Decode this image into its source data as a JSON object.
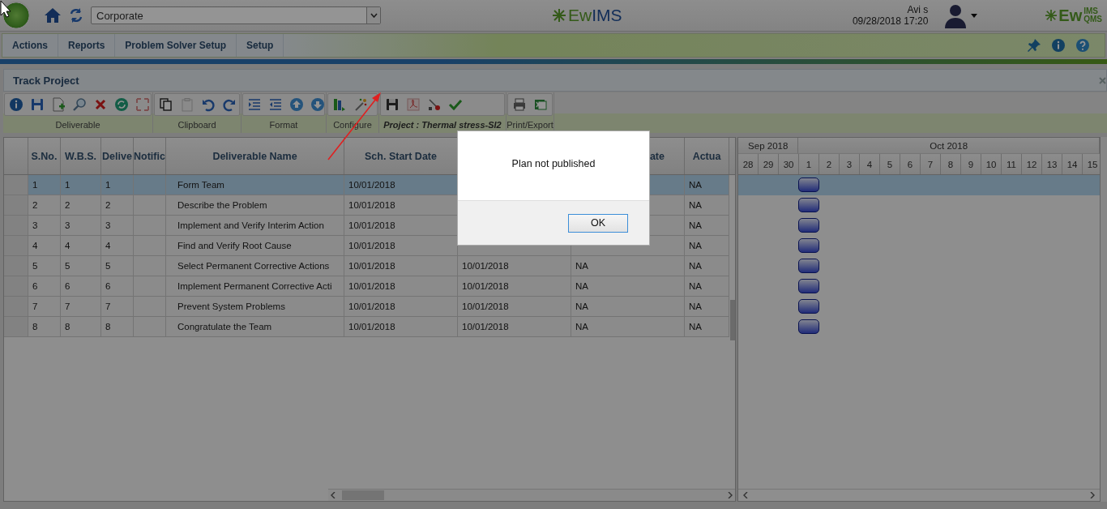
{
  "header": {
    "organization": "Corporate",
    "brand_first": "Ew",
    "brand_second": "IMS",
    "user_name": "Avi s",
    "datetime": "09/28/2018 17:20",
    "corner_logo": {
      "main": "Ew",
      "top": "IMS",
      "bottom": "QMS"
    }
  },
  "menu": [
    "Actions",
    "Reports",
    "Problem Solver Setup",
    "Setup"
  ],
  "panel": {
    "title": "Track Project"
  },
  "toolbar": {
    "groups": [
      {
        "label": "Deliverable"
      },
      {
        "label": "Clipboard"
      },
      {
        "label": "Format"
      },
      {
        "label": "Configure"
      },
      {
        "label": "Project : Thermal stress-SI2"
      },
      {
        "label": "Print/Export"
      }
    ]
  },
  "table": {
    "columns": [
      "S.No.",
      "W.B.S.",
      "Delive",
      "Notific",
      "Deliverable Name",
      "Sch. Start Date",
      "",
      "ate",
      "Actua"
    ],
    "rows": [
      {
        "selected": true,
        "cells": [
          "1",
          "1",
          "1",
          "",
          "Form Team",
          "10/01/2018",
          "",
          "",
          "NA"
        ]
      },
      {
        "selected": false,
        "cells": [
          "2",
          "2",
          "2",
          "",
          "Describe the Problem",
          "10/01/2018",
          "",
          "",
          "NA"
        ]
      },
      {
        "selected": false,
        "cells": [
          "3",
          "3",
          "3",
          "",
          "Implement and Verify Interim Action",
          "10/01/2018",
          "",
          "",
          "NA"
        ]
      },
      {
        "selected": false,
        "cells": [
          "4",
          "4",
          "4",
          "",
          "Find and Verify Root Cause",
          "10/01/2018",
          "",
          "",
          "NA"
        ]
      },
      {
        "selected": false,
        "cells": [
          "5",
          "5",
          "5",
          "",
          "Select Permanent Corrective Actions",
          "10/01/2018",
          "10/01/2018",
          "NA",
          "NA"
        ]
      },
      {
        "selected": false,
        "cells": [
          "6",
          "6",
          "6",
          "",
          "Implement Permanent Corrective Acti",
          "10/01/2018",
          "10/01/2018",
          "NA",
          "NA"
        ]
      },
      {
        "selected": false,
        "cells": [
          "7",
          "7",
          "7",
          "",
          "Prevent System Problems",
          "10/01/2018",
          "10/01/2018",
          "NA",
          "NA"
        ]
      },
      {
        "selected": false,
        "cells": [
          "8",
          "8",
          "8",
          "",
          "Congratulate the Team",
          "10/01/2018",
          "10/01/2018",
          "NA",
          "NA"
        ]
      }
    ]
  },
  "gantt": {
    "months": [
      {
        "label": "Sep 2018",
        "days": [
          "28",
          "29",
          "30"
        ]
      },
      {
        "label": "Oct 2018",
        "days": [
          "1",
          "2",
          "3",
          "4",
          "5",
          "6",
          "7",
          "8",
          "9",
          "10",
          "11",
          "12",
          "13",
          "14",
          "15"
        ]
      }
    ]
  },
  "dialog": {
    "message": "Plan not published",
    "button": "OK"
  }
}
